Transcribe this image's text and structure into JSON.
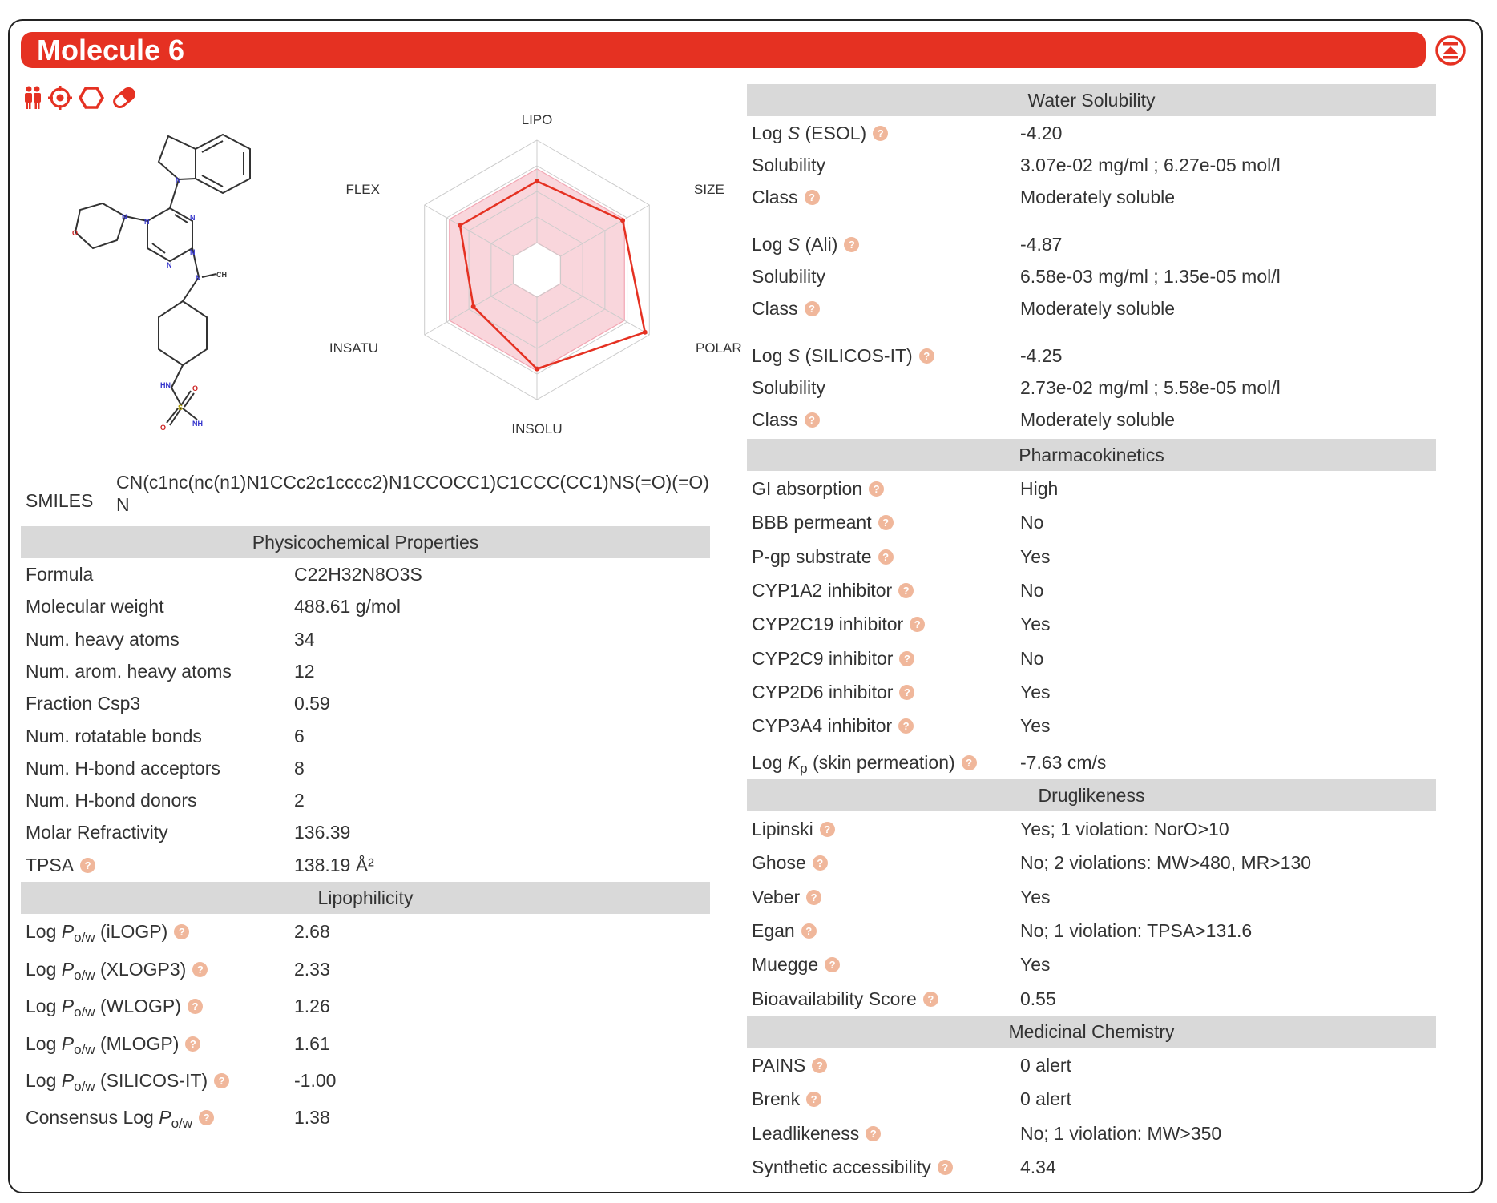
{
  "header": {
    "title": "Molecule 6"
  },
  "type_icons": [
    "flexibility-icon",
    "target-icon",
    "ring-icon",
    "pill-icon"
  ],
  "radar": {
    "axes": [
      "LIPO",
      "SIZE",
      "POLAR",
      "INSOLU",
      "INSATU",
      "FLEX"
    ],
    "values": [
      0.6,
      0.7,
      0.95,
      0.7,
      0.45,
      0.6
    ]
  },
  "smiles": {
    "label": "SMILES",
    "value": "CN(c1nc(nc(n1)N1CCc2c1cccc2)N1CCOCC1)C1CCC(CC1)NS(=O)(=O)N"
  },
  "physchem": {
    "title": "Physicochemical Properties",
    "rows": [
      {
        "label": "Formula",
        "value": "C22H32N8O3S"
      },
      {
        "label": "Molecular weight",
        "value": "488.61 g/mol"
      },
      {
        "label": "Num. heavy atoms",
        "value": "34"
      },
      {
        "label": "Num. arom. heavy atoms",
        "value": "12"
      },
      {
        "label": "Fraction Csp3",
        "value": "0.59"
      },
      {
        "label": "Num. rotatable bonds",
        "value": "6"
      },
      {
        "label": "Num. H-bond acceptors",
        "value": "8"
      },
      {
        "label": "Num. H-bond donors",
        "value": "2"
      },
      {
        "label": "Molar Refractivity",
        "value": "136.39"
      },
      {
        "label": "TPSA",
        "value": "138.19 Å²"
      }
    ]
  },
  "lipo": {
    "title": "Lipophilicity",
    "log": "Log",
    "consensus": "Consensus Log",
    "p": "P",
    "sub": "o/w",
    "rows": [
      {
        "method": "(iLOGP)",
        "value": "2.68"
      },
      {
        "method": "(XLOGP3)",
        "value": "2.33"
      },
      {
        "method": "(WLOGP)",
        "value": "1.26"
      },
      {
        "method": "(MLOGP)",
        "value": "1.61"
      },
      {
        "method": "(SILICOS-IT)",
        "value": "-1.00"
      }
    ],
    "consensus_value": "1.38"
  },
  "solubility": {
    "title": "Water Solubility",
    "log": "Log",
    "s": "S",
    "sol_label": "Solubility",
    "class_label": "Class",
    "groups": [
      {
        "method": "(ESOL)",
        "logs": "-4.20",
        "solubility": "3.07e-02 mg/ml ; 6.27e-05 mol/l",
        "class": "Moderately soluble"
      },
      {
        "method": "(Ali)",
        "logs": "-4.87",
        "solubility": "6.58e-03 mg/ml ; 1.35e-05 mol/l",
        "class": "Moderately soluble"
      },
      {
        "method": "(SILICOS-IT)",
        "logs": "-4.25",
        "solubility": "2.73e-02 mg/ml ; 5.58e-05 mol/l",
        "class": "Moderately soluble"
      }
    ]
  },
  "pk": {
    "title": "Pharmacokinetics",
    "rows": [
      {
        "label": "GI absorption",
        "value": "High"
      },
      {
        "label": "BBB permeant",
        "value": "No"
      },
      {
        "label": "P-gp substrate",
        "value": "Yes"
      },
      {
        "label": "CYP1A2 inhibitor",
        "value": "No"
      },
      {
        "label": "CYP2C19 inhibitor",
        "value": "Yes"
      },
      {
        "label": "CYP2C9 inhibitor",
        "value": "No"
      },
      {
        "label": "CYP2D6 inhibitor",
        "value": "Yes"
      },
      {
        "label": "CYP3A4 inhibitor",
        "value": "Yes"
      }
    ],
    "kp": {
      "log": "Log",
      "k": "K",
      "sub": "p",
      "rest": "(skin permeation)",
      "value": "-7.63 cm/s"
    }
  },
  "druglikeness": {
    "title": "Druglikeness",
    "rows": [
      {
        "label": "Lipinski",
        "value": "Yes; 1 violation: NorO>10"
      },
      {
        "label": "Ghose",
        "value": "No; 2 violations: MW>480, MR>130"
      },
      {
        "label": "Veber",
        "value": "Yes"
      },
      {
        "label": "Egan",
        "value": "No; 1 violation: TPSA>131.6"
      },
      {
        "label": "Muegge",
        "value": "Yes"
      },
      {
        "label": "Bioavailability Score",
        "value": "0.55"
      }
    ]
  },
  "medchem": {
    "title": "Medicinal Chemistry",
    "rows": [
      {
        "label": "PAINS",
        "value": "0 alert"
      },
      {
        "label": "Brenk",
        "value": "0 alert"
      },
      {
        "label": "Leadlikeness",
        "value": "No; 1 violation: MW>350"
      },
      {
        "label": "Synthetic accessibility",
        "value": "4.34"
      }
    ]
  },
  "molecule_labels": {
    "n": "N",
    "o": "O",
    "s": "S",
    "ch3": "CH",
    "hn": "HN",
    "nh2": "NH"
  },
  "help_glyph": "?",
  "colors": {
    "accent": "#e53122",
    "header_bg": "#d9d9d9",
    "help": "#f0b79b"
  }
}
